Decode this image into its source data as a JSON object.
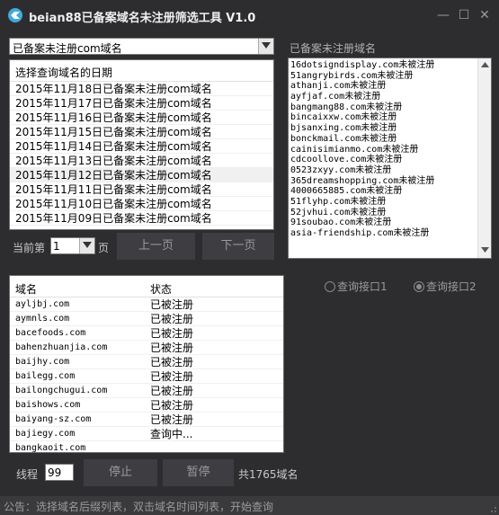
{
  "window": {
    "title": "beian88已备案域名未注册筛选工具 V1.0",
    "minimize": "—",
    "maximize": "☐",
    "close": "✕"
  },
  "filter": {
    "selected": "已备案未注册com域名"
  },
  "date_list": {
    "header": "选择查询域名的日期",
    "items": [
      "2015年11月18日已备案未注册com域名",
      "2015年11月17日已备案未注册com域名",
      "2015年11月16日已备案未注册com域名",
      "2015年11月15日已备案未注册com域名",
      "2015年11月14日已备案未注册com域名",
      "2015年11月13日已备案未注册com域名",
      "2015年11月12日已备案未注册com域名",
      "2015年11月11日已备案未注册com域名",
      "2015年11月10日已备案未注册com域名",
      "2015年11月09日已备案未注册com域名"
    ]
  },
  "pager": {
    "current_label": "当前第",
    "page_value": "1",
    "page_suffix": "页",
    "prev_label": "上一页",
    "next_label": "下一页"
  },
  "results": {
    "label": "已备案未注册域名",
    "lines": [
      "16dotsigndisplay.com未被注册",
      "51angrybirds.com未被注册",
      "athanji.com未被注册",
      "ayfjaf.com未被注册",
      "bangmang88.com未被注册",
      "bincaixxw.com未被注册",
      "bjsanxing.com未被注册",
      "bonckmail.com未被注册",
      "cainisimianmo.com未被注册",
      "cdcoollove.com未被注册",
      "0523zxyy.com未被注册",
      "365dreamshopping.com未被注册",
      "4000665885.com未被注册",
      "51flyhp.com未被注册",
      "52jvhui.com未被注册",
      "91soubao.com未被注册",
      "asia-friendship.com未被注册"
    ]
  },
  "domain_table": {
    "col_domain": "域名",
    "col_status": "状态",
    "rows": [
      {
        "domain": "ayljbj.com",
        "status": "已被注册"
      },
      {
        "domain": "aymnls.com",
        "status": "已被注册"
      },
      {
        "domain": "bacefoods.com",
        "status": "已被注册"
      },
      {
        "domain": "bahenzhuanjia.com",
        "status": "已被注册"
      },
      {
        "domain": "baijhy.com",
        "status": "已被注册"
      },
      {
        "domain": "bailegg.com",
        "status": "已被注册"
      },
      {
        "domain": "bailongchugui.com",
        "status": "已被注册"
      },
      {
        "domain": "baishows.com",
        "status": "已被注册"
      },
      {
        "domain": "baiyang-sz.com",
        "status": "已被注册"
      },
      {
        "domain": "bajiegy.com",
        "status": "查询中..."
      },
      {
        "domain": "bangkaoit.com",
        "status": ""
      }
    ]
  },
  "api": {
    "option1": "查询接口1",
    "option2": "查询接口2",
    "selected": "查询接口2"
  },
  "controls": {
    "thread_label": "线程",
    "thread_value": "99",
    "stop_label": "停止",
    "pause_label": "暂停",
    "total_text": "共1765域名"
  },
  "status_bar": {
    "text": "公告：选择域名后缀列表，双击域名时间列表，开始查询"
  },
  "colors": {
    "background": "#2d2d30",
    "panel": "#ffffff",
    "button": "#3e3e42",
    "text": "#c8c8c8"
  }
}
